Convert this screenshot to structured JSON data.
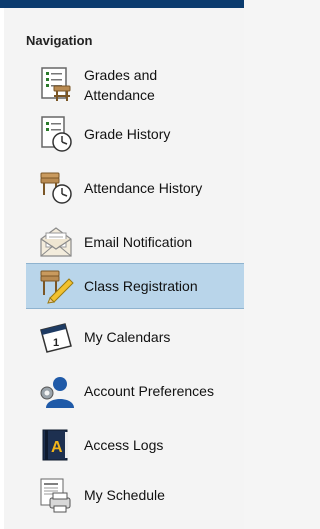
{
  "navigation": {
    "title": "Navigation",
    "items": [
      {
        "label": "Grades and Attendance",
        "icon": "grades-attendance-icon"
      },
      {
        "label": "Grade History",
        "icon": "grade-history-icon"
      },
      {
        "label": "Attendance History",
        "icon": "attendance-history-icon"
      },
      {
        "label": "Email Notification",
        "icon": "email-notification-icon"
      },
      {
        "label": "Class Registration",
        "icon": "class-registration-icon",
        "active": true
      },
      {
        "label": "My Calendars",
        "icon": "calendar-icon"
      },
      {
        "label": "Account Preferences",
        "icon": "account-preferences-icon"
      },
      {
        "label": "Access Logs",
        "icon": "access-logs-icon"
      },
      {
        "label": "My Schedule",
        "icon": "schedule-icon"
      }
    ]
  },
  "colors": {
    "header_bar": "#0b3b6e",
    "active_background": "#b9d5ea"
  }
}
